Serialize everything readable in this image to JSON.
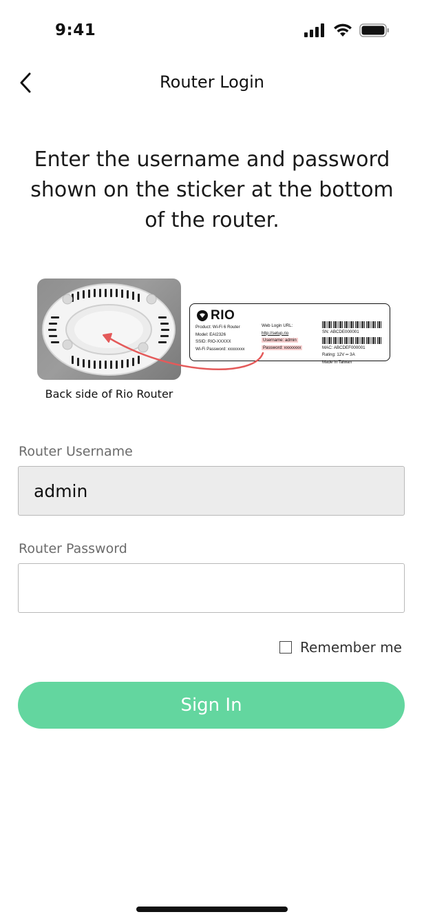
{
  "status_bar": {
    "time": "9:41",
    "icons": [
      "signal-icon",
      "wifi-icon",
      "battery-icon"
    ]
  },
  "nav": {
    "back_icon": "chevron-left-icon",
    "title": "Router Login"
  },
  "instruction": "Enter the username and password shown on the sticker at the bottom of the router.",
  "router_image": {
    "caption": "Back side of Rio Router"
  },
  "sticker": {
    "brand": "RIO",
    "product": "Product: Wi-Fi 6 Router",
    "model": "Model: EAI2326",
    "ssid": "SSID: RIO-XXXXX",
    "wifi_password": "Wi-Fi Password: xxxxxxxx",
    "web_login_label": "Web Login URL:",
    "web_login_url": "http://setup.rio",
    "username": "Username: admin",
    "password": "Password: xxxxxxxx",
    "sn": "SN: ABCDE000001",
    "mac": "MAC: ABCDEF000001",
    "rating": "Rating: 12V ═ 3A",
    "made_in": "Made in Taiwan"
  },
  "form": {
    "username_label": "Router Username",
    "username_value": "admin",
    "password_label": "Router Password",
    "password_value": "",
    "remember_label": "Remember me",
    "remember_checked": false,
    "signin_label": "Sign In"
  },
  "colors": {
    "accent": "#63d69f",
    "highlight": "#f8d0d0",
    "arrow": "#e45a5a",
    "filled_field": "#ececec"
  }
}
